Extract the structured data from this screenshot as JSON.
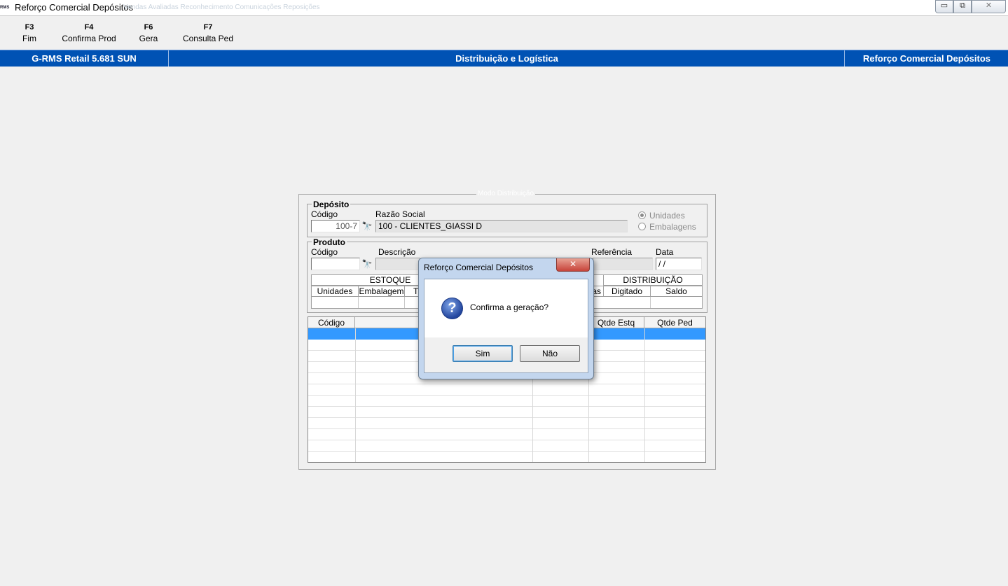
{
  "window": {
    "logo_text": "RMS",
    "title": "Reforço Comercial Depósitos",
    "ghost_text": "Vendas Avaliadas    Reconhecimento Comunicações    Reposições",
    "min": "▭",
    "restore": "⧉",
    "close": "✕"
  },
  "fkeys": [
    {
      "key": "F3",
      "label": "Fim"
    },
    {
      "key": "F4",
      "label": "Confirma Prod"
    },
    {
      "key": "F6",
      "label": "Gera"
    },
    {
      "key": "F7",
      "label": "Consulta Ped"
    }
  ],
  "header": {
    "left": "G-RMS Retail 5.681 SUN",
    "center": "Distribuição e Logística",
    "right": "Reforço Comercial Depósitos"
  },
  "main": {
    "caption": "Modo Distribuição",
    "deposito": {
      "title": "Depósito",
      "codigo_label": "Código",
      "codigo_value": "100-7",
      "razao_label": "Razão Social",
      "razao_value": "100 - CLIENTES_GIASSI D",
      "radio_unidades": "Unidades",
      "radio_embalagens": "Embalagens",
      "selected": "Unidades"
    },
    "produto": {
      "title": "Produto",
      "codigo_label": "Código",
      "descricao_label": "Descrição",
      "referencia_label": "Referência",
      "data_label": "Data",
      "data_value": " / /",
      "estoque_header": "ESTOQUE",
      "estoque_cols": [
        "Unidades",
        "Embalagem",
        "T"
      ],
      "partial_col": "as",
      "distribuicao_header": "DISTRIBUIÇÃO",
      "distribuicao_cols": [
        "Digitado",
        "Saldo"
      ]
    },
    "grid": {
      "columns": [
        "Código",
        "",
        "",
        "Qtde Estq",
        "Qtde Ped"
      ]
    }
  },
  "dialog": {
    "title": "Reforço Comercial Depósitos",
    "close": "✕",
    "icon": "?",
    "message": "Confirma a geração?",
    "yes": "Sim",
    "no": "Não"
  },
  "icons": {
    "binoculars": "🔭"
  }
}
